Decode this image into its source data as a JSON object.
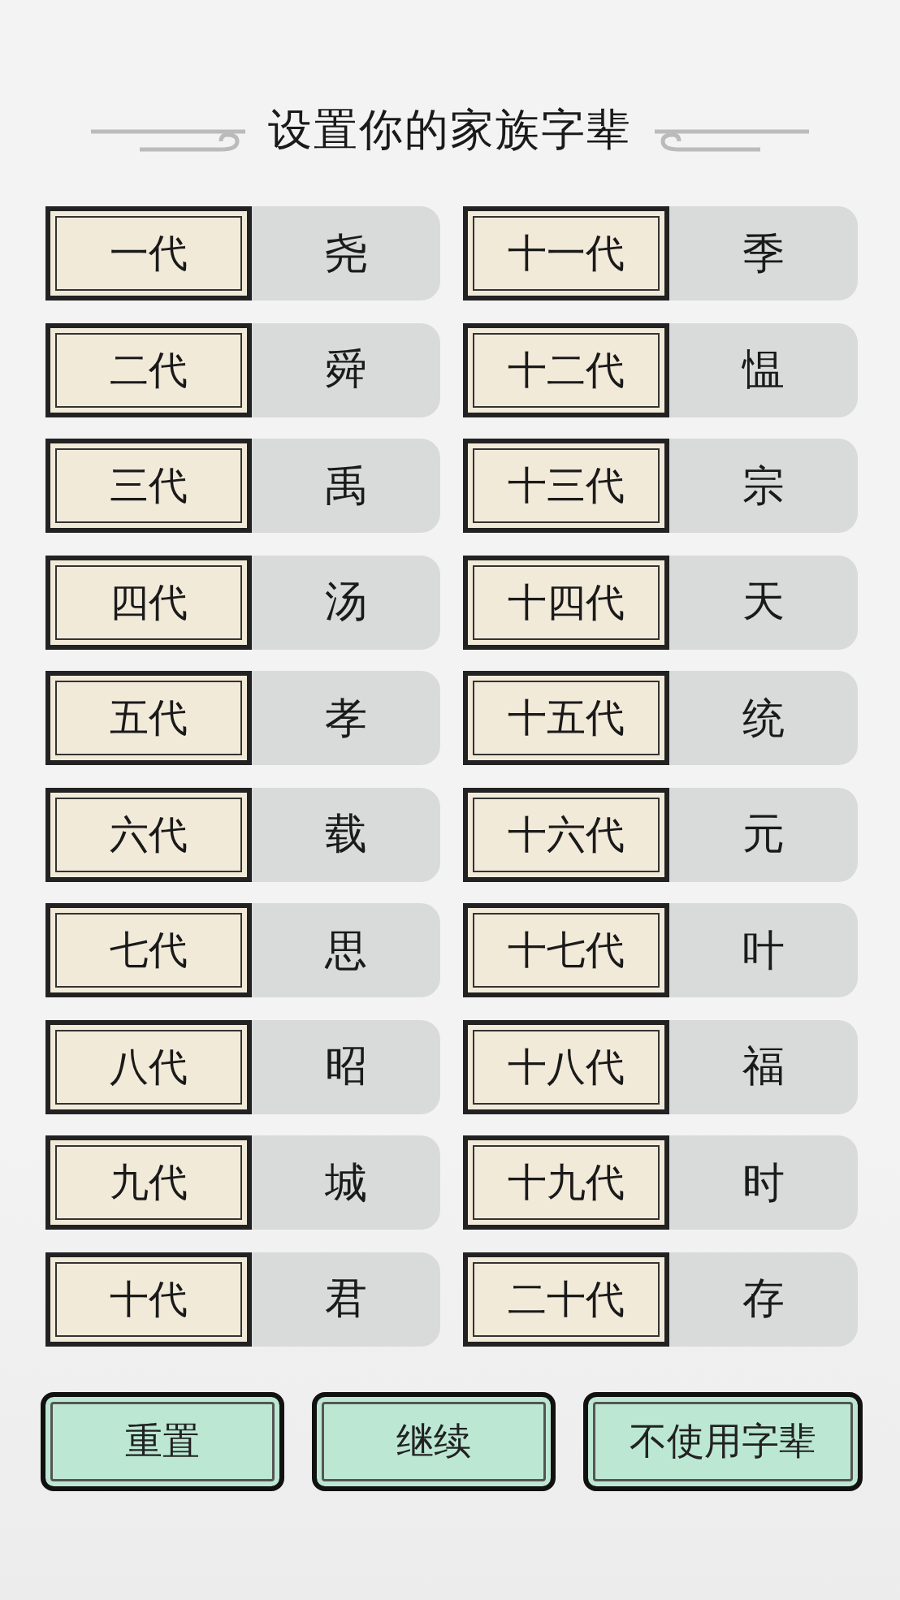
{
  "title": "设置你的家族字辈",
  "generations": [
    {
      "label": "一代",
      "name": "尧"
    },
    {
      "label": "二代",
      "name": "舜"
    },
    {
      "label": "三代",
      "name": "禹"
    },
    {
      "label": "四代",
      "name": "汤"
    },
    {
      "label": "五代",
      "name": "孝"
    },
    {
      "label": "六代",
      "name": "载"
    },
    {
      "label": "七代",
      "name": "思"
    },
    {
      "label": "八代",
      "name": "昭"
    },
    {
      "label": "九代",
      "name": "城"
    },
    {
      "label": "十代",
      "name": "君"
    },
    {
      "label": "十一代",
      "name": "季"
    },
    {
      "label": "十二代",
      "name": "愠"
    },
    {
      "label": "十三代",
      "name": "宗"
    },
    {
      "label": "十四代",
      "name": "天"
    },
    {
      "label": "十五代",
      "name": "统"
    },
    {
      "label": "十六代",
      "name": "元"
    },
    {
      "label": "十七代",
      "name": "叶"
    },
    {
      "label": "十八代",
      "name": "福"
    },
    {
      "label": "十九代",
      "name": "时"
    },
    {
      "label": "二十代",
      "name": "存"
    }
  ],
  "buttons": [
    "重置",
    "继续",
    "不使用字辈"
  ]
}
